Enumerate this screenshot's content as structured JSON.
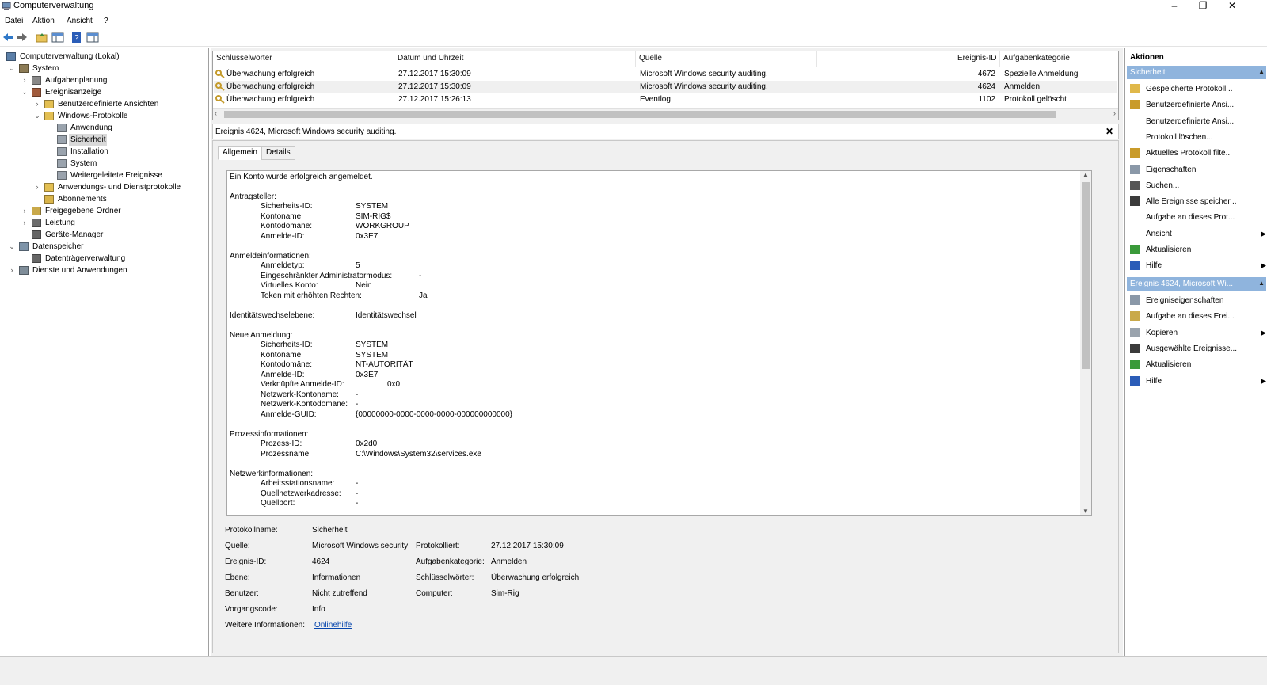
{
  "window": {
    "title": "Computerverwaltung",
    "min": "–",
    "restore": "❐",
    "close": "✕"
  },
  "menu": [
    "Datei",
    "Aktion",
    "Ansicht",
    "?"
  ],
  "tree": [
    {
      "label": "Computerverwaltung (Lokal)",
      "icon": "computer-icon",
      "expand": ""
    },
    {
      "label": "System",
      "icon": "tools-icon",
      "expand": "v"
    },
    {
      "label": "Aufgabenplanung",
      "icon": "clock-icon",
      "expand": ">"
    },
    {
      "label": "Ereignisanzeige",
      "icon": "event-viewer-icon",
      "expand": "v"
    },
    {
      "label": "Benutzerdefinierte Ansichten",
      "icon": "folder-icon",
      "expand": ">"
    },
    {
      "label": "Windows-Protokolle",
      "icon": "folder-icon",
      "expand": "v"
    },
    {
      "label": "Anwendung",
      "icon": "log-icon",
      "expand": ""
    },
    {
      "label": "Sicherheit",
      "icon": "log-icon",
      "expand": ""
    },
    {
      "label": "Installation",
      "icon": "log-icon",
      "expand": ""
    },
    {
      "label": "System",
      "icon": "log-icon",
      "expand": ""
    },
    {
      "label": "Weitergeleitete Ereignisse",
      "icon": "log-icon",
      "expand": ""
    },
    {
      "label": "Anwendungs- und Dienstprotokolle",
      "icon": "folder-icon",
      "expand": ">"
    },
    {
      "label": "Abonnements",
      "icon": "subscription-icon",
      "expand": ""
    },
    {
      "label": "Freigegebene Ordner",
      "icon": "shared-folder-icon",
      "expand": ">"
    },
    {
      "label": "Leistung",
      "icon": "performance-icon",
      "expand": ">"
    },
    {
      "label": "Geräte-Manager",
      "icon": "device-manager-icon",
      "expand": ""
    },
    {
      "label": "Datenspeicher",
      "icon": "storage-icon",
      "expand": "v"
    },
    {
      "label": "Datenträgerverwaltung",
      "icon": "disk-icon",
      "expand": ""
    },
    {
      "label": "Dienste und Anwendungen",
      "icon": "services-icon",
      "expand": ">"
    }
  ],
  "list": {
    "headers": [
      "Schlüsselwörter",
      "Datum und Uhrzeit",
      "Quelle",
      "Ereignis-ID",
      "Aufgabenkategorie"
    ],
    "rows": [
      [
        "Überwachung erfolgreich",
        "27.12.2017 15:30:09",
        "Microsoft Windows security auditing.",
        "4672",
        "Spezielle Anmeldung"
      ],
      [
        "Überwachung erfolgreich",
        "27.12.2017 15:30:09",
        "Microsoft Windows security auditing.",
        "4624",
        "Anmelden"
      ],
      [
        "Überwachung erfolgreich",
        "27.12.2017 15:26:13",
        "Eventlog",
        "1102",
        "Protokoll gelöscht"
      ]
    ]
  },
  "detail": {
    "title": "Ereignis 4624, Microsoft Windows security auditing.",
    "tabs": [
      "Allgemein",
      "Details"
    ],
    "description": [
      {
        "t": "Ein Konto wurde erfolgreich angemeldet.",
        "indent": 0,
        "v": ""
      },
      {
        "t": "Antragsteller:",
        "indent": 0,
        "v": ""
      },
      {
        "t": "Sicherheits-ID:",
        "indent": 1,
        "v": "SYSTEM"
      },
      {
        "t": "Kontoname:",
        "indent": 1,
        "v": "SIM-RIG$"
      },
      {
        "t": "Kontodomäne:",
        "indent": 1,
        "v": "WORKGROUP"
      },
      {
        "t": "Anmelde-ID:",
        "indent": 1,
        "v": "0x3E7"
      },
      {
        "t": "Anmeldeinformationen:",
        "indent": 0,
        "v": ""
      },
      {
        "t": "Anmeldetyp:",
        "indent": 1,
        "v": "5"
      },
      {
        "t": "Eingeschränkter Administratormodus:",
        "indent": 1,
        "v": "-"
      },
      {
        "t": "Virtuelles Konto:",
        "indent": 1,
        "v": "Nein"
      },
      {
        "t": "Token mit erhöhten Rechten:",
        "indent": 1,
        "v": "Ja"
      },
      {
        "t": "Identitätswechselebene:",
        "indent": 0,
        "v": "Identitätswechsel"
      },
      {
        "t": "Neue Anmeldung:",
        "indent": 0,
        "v": ""
      },
      {
        "t": "Sicherheits-ID:",
        "indent": 1,
        "v": "SYSTEM"
      },
      {
        "t": "Kontoname:",
        "indent": 1,
        "v": "SYSTEM"
      },
      {
        "t": "Kontodomäne:",
        "indent": 1,
        "v": "NT-AUTORITÄT"
      },
      {
        "t": "Anmelde-ID:",
        "indent": 1,
        "v": "0x3E7"
      },
      {
        "t": "Verknüpfte Anmelde-ID:",
        "indent": 1,
        "v": "0x0"
      },
      {
        "t": "Netzwerk-Kontoname:",
        "indent": 1,
        "v": "-"
      },
      {
        "t": "Netzwerk-Kontodomäne:",
        "indent": 1,
        "v": "-"
      },
      {
        "t": "Anmelde-GUID:",
        "indent": 1,
        "v": "{00000000-0000-0000-0000-000000000000}"
      },
      {
        "t": "Prozessinformationen:",
        "indent": 0,
        "v": ""
      },
      {
        "t": "Prozess-ID:",
        "indent": 1,
        "v": "0x2d0"
      },
      {
        "t": "Prozessname:",
        "indent": 1,
        "v": "C:\\Windows\\System32\\services.exe"
      },
      {
        "t": "Netzwerkinformationen:",
        "indent": 0,
        "v": ""
      },
      {
        "t": "Arbeitsstationsname:",
        "indent": 1,
        "v": "-"
      },
      {
        "t": "Quellnetzwerkadresse:",
        "indent": 1,
        "v": "-"
      },
      {
        "t": "Quellport:",
        "indent": 1,
        "v": "-"
      }
    ],
    "props": {
      "protokollname_l": "Protokollname:",
      "protokollname": "Sicherheit",
      "quelle_l": "Quelle:",
      "quelle": "Microsoft Windows security",
      "protokolliert_l": "Protokolliert:",
      "protokolliert": "27.12.2017 15:30:09",
      "ereignisid_l": "Ereignis-ID:",
      "ereignisid": "4624",
      "aufgabenkat_l": "Aufgabenkategorie:",
      "aufgabenkat": "Anmelden",
      "ebene_l": "Ebene:",
      "ebene": "Informationen",
      "schluessel_l": "Schlüsselwörter:",
      "schluessel": "Überwachung erfolgreich",
      "benutzer_l": "Benutzer:",
      "benutzer": "Nicht zutreffend",
      "computer_l": "Computer:",
      "computer": "Sim-Rig",
      "vorgang_l": "Vorgangscode:",
      "vorgang": "Info",
      "weitere_l": "Weitere Informationen:",
      "weitere": "Onlinehilfe"
    }
  },
  "actions": {
    "header": "Aktionen",
    "section1": "Sicherheit",
    "items1": [
      {
        "label": "Gespeicherte Protokoll...",
        "icon": "open-log-icon",
        "sub": ""
      },
      {
        "label": "Benutzerdefinierte Ansi...",
        "icon": "filter-icon",
        "sub": ""
      },
      {
        "label": "Benutzerdefinierte Ansi...",
        "icon": "",
        "sub": ""
      },
      {
        "label": "Protokoll löschen...",
        "icon": "",
        "sub": ""
      },
      {
        "label": "Aktuelles Protokoll filte...",
        "icon": "filter-icon",
        "sub": ""
      },
      {
        "label": "Eigenschaften",
        "icon": "properties-icon",
        "sub": ""
      },
      {
        "label": "Suchen...",
        "icon": "binoculars-icon",
        "sub": ""
      },
      {
        "label": "Alle Ereignisse speicher...",
        "icon": "save-icon",
        "sub": ""
      },
      {
        "label": "Aufgabe an dieses Prot...",
        "icon": "",
        "sub": ""
      },
      {
        "label": "Ansicht",
        "icon": "",
        "sub": "▶"
      },
      {
        "label": "Aktualisieren",
        "icon": "refresh-icon",
        "sub": ""
      },
      {
        "label": "Hilfe",
        "icon": "help-icon",
        "sub": "▶"
      }
    ],
    "section2": "Ereignis 4624, Microsoft Wi...",
    "items2": [
      {
        "label": "Ereigniseigenschaften",
        "icon": "properties-icon",
        "sub": ""
      },
      {
        "label": "Aufgabe an dieses Erei...",
        "icon": "task-icon",
        "sub": ""
      },
      {
        "label": "Kopieren",
        "icon": "copy-icon",
        "sub": "▶"
      },
      {
        "label": "Ausgewählte Ereignisse...",
        "icon": "save-icon",
        "sub": ""
      },
      {
        "label": "Aktualisieren",
        "icon": "refresh-icon",
        "sub": ""
      },
      {
        "label": "Hilfe",
        "icon": "help-icon",
        "sub": "▶"
      }
    ]
  },
  "colors": {
    "accent": "#8fb4dd",
    "selection": "#d9d9d9",
    "link": "#0645ad"
  }
}
